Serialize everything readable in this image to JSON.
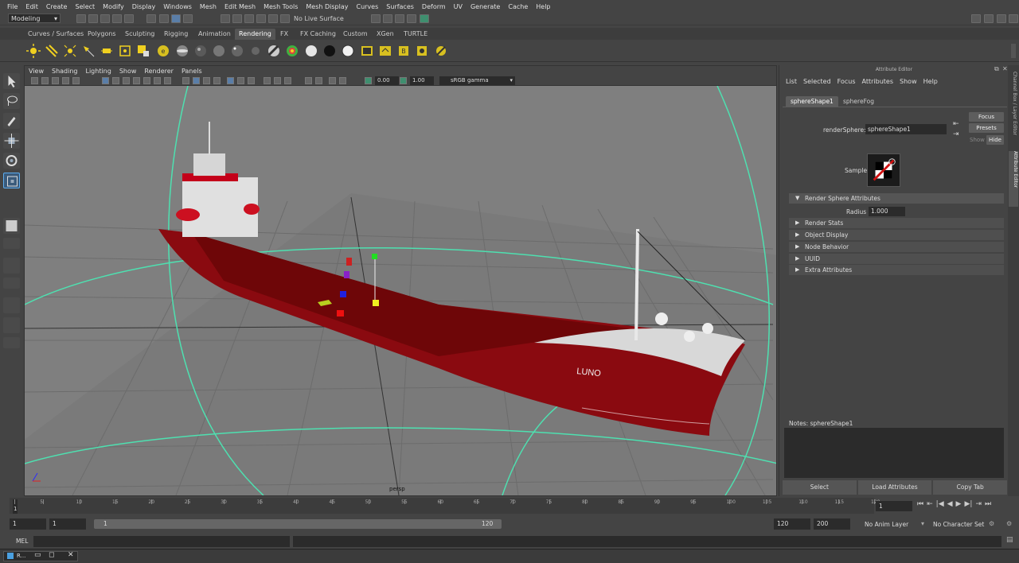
{
  "menubar": {
    "items": [
      "File",
      "Edit",
      "Create",
      "Select",
      "Modify",
      "Display",
      "Windows",
      "Mesh",
      "Edit Mesh",
      "Mesh Tools",
      "Mesh Display",
      "Curves",
      "Surfaces",
      "Deform",
      "UV",
      "Generate",
      "Cache",
      "Help"
    ]
  },
  "status": {
    "mode": "Modeling",
    "live_surface": "No Live Surface"
  },
  "shelf_tabs": [
    "Curves / Surfaces",
    "Polygons",
    "Sculpting",
    "Rigging",
    "Animation",
    "Rendering",
    "FX",
    "FX Caching",
    "Custom",
    "XGen",
    "TURTLE"
  ],
  "shelf_active": "Rendering",
  "viewport": {
    "menu": [
      "View",
      "Shading",
      "Lighting",
      "Show",
      "Renderer",
      "Panels"
    ],
    "exposure": "0.00",
    "gamma_value": "1.00",
    "color_space": "sRGB gamma",
    "camera": "persp",
    "ship_name": "LUNO"
  },
  "attribute_editor": {
    "title": "Attribute Editor",
    "menu": [
      "List",
      "Selected",
      "Focus",
      "Attributes",
      "Show",
      "Help"
    ],
    "tabs": [
      "sphereShape1",
      "sphereFog"
    ],
    "render_sphere_label": "renderSphere:",
    "render_sphere_value": "sphereShape1",
    "buttons": {
      "focus": "Focus",
      "presets": "Presets",
      "show": "Show",
      "hide": "Hide"
    },
    "sample_label": "Sample",
    "sections": [
      "Render Sphere Attributes",
      "Render Stats",
      "Object Display",
      "Node Behavior",
      "UUID",
      "Extra Attributes"
    ],
    "radius_label": "Radius",
    "radius_value": "1.000",
    "notes_label": "Notes:  sphereShape1",
    "bottom_buttons": [
      "Select",
      "Load Attributes",
      "Copy Tab"
    ]
  },
  "side_tabs": [
    "Channel Box / Layer Editor",
    "Attribute Editor"
  ],
  "timeline": {
    "ticks": [
      "1",
      "5",
      "10",
      "15",
      "20",
      "25",
      "30",
      "35",
      "40",
      "45",
      "50",
      "55",
      "60",
      "65",
      "70",
      "75",
      "80",
      "85",
      "90",
      "95",
      "100",
      "105",
      "110",
      "115",
      "120"
    ],
    "current_frame": "1",
    "current_frame_field": "1"
  },
  "range": {
    "start": "1",
    "start2": "1",
    "slider_start": "1",
    "slider_end": "120",
    "end": "120",
    "end2": "200",
    "anim_layer": "No Anim Layer",
    "char_set": "No Character Set"
  },
  "cmdline": {
    "label": "MEL"
  },
  "taskbar": {
    "label": "R..."
  }
}
